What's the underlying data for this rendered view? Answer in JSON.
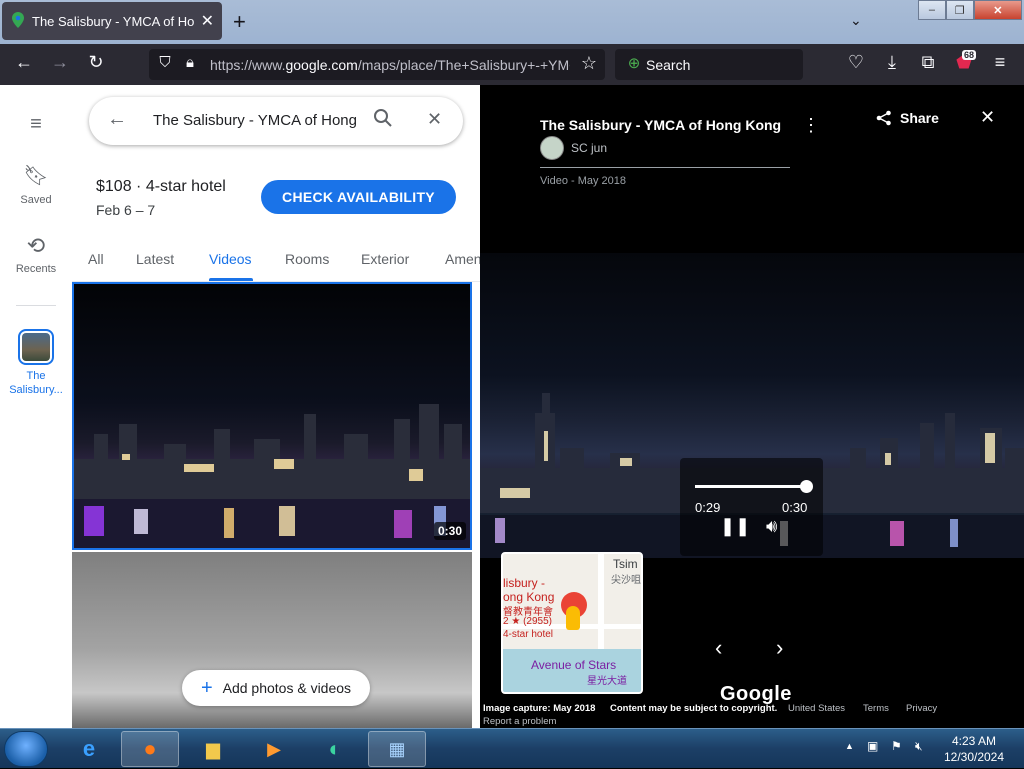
{
  "browser": {
    "tab_title": "The Salisbury - YMCA of Hong Kong",
    "url_prefix": "https://www.",
    "url_domain": "google.com",
    "url_rest": "/maps/place/The+Salisbury+-+YMCA+of+Hong+Kong",
    "search_placeholder": "Search",
    "extension_badge": "68"
  },
  "rail": {
    "saved": "Saved",
    "recents": "Recents",
    "place": "The Salisbury..."
  },
  "panel": {
    "search_value": "The Salisbury - YMCA of Hong Kong",
    "price": "$108 · 4-star hotel",
    "dates": "Feb 6 – 7",
    "cta": "CHECK AVAILABILITY",
    "tabs": [
      "All",
      "Latest",
      "Videos",
      "Rooms",
      "Exterior",
      "Amenities"
    ],
    "active_tab": "Videos",
    "video_duration": "0:30",
    "add_label": "Add photos & videos"
  },
  "viewer": {
    "title": "The Salisbury - YMCA of Hong Kong",
    "author": "SC jun",
    "meta": "Video - May 2018",
    "share": "Share",
    "time_current": "0:29",
    "time_total": "0:30",
    "progress": 0.97,
    "google": "Google",
    "map_labels": {
      "tsim": "Tsim",
      "tsim_cn": "尖沙咀",
      "hotel1": "lisbury -",
      "hotel2": "ong Kong",
      "hotel_cn": "督教青年會",
      "rating": "2 ★ (2955)",
      "hotel_class": "4-star hotel",
      "avenue": "Avenue of Stars",
      "avenue_cn": "星光大道"
    },
    "footer": {
      "capture": "Image capture: May 2018",
      "copyright": "Content may be subject to copyright.",
      "region": "United States",
      "terms": "Terms",
      "privacy": "Privacy",
      "report": "Report a problem"
    }
  },
  "taskbar": {
    "time": "4:23 AM",
    "date": "12/30/2024"
  }
}
